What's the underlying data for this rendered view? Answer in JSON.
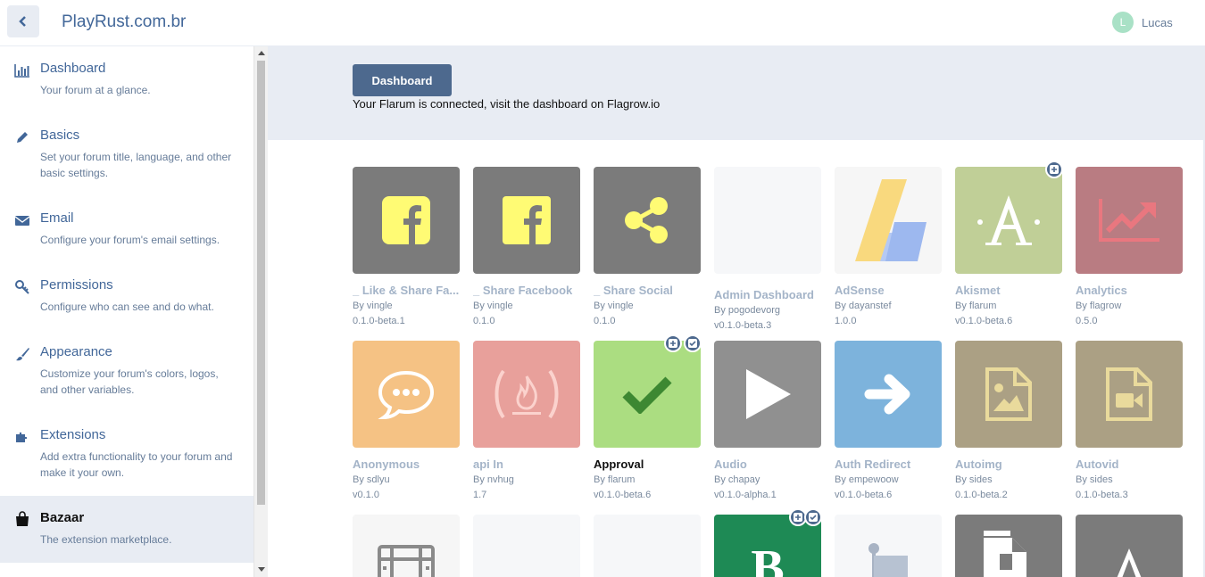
{
  "header": {
    "site_title": "PlayRust.com.br",
    "user_initial": "L",
    "user_name": "Lucas"
  },
  "sidebar": {
    "items": [
      {
        "label": "Dashboard",
        "desc": "Your forum at a glance.",
        "icon": "chart-icon"
      },
      {
        "label": "Basics",
        "desc": "Set your forum title, language, and other basic settings.",
        "icon": "pencil-icon"
      },
      {
        "label": "Email",
        "desc": "Configure your forum's email settings.",
        "icon": "envelope-icon"
      },
      {
        "label": "Permissions",
        "desc": "Configure who can see and do what.",
        "icon": "key-icon"
      },
      {
        "label": "Appearance",
        "desc": "Customize your forum's colors, logos, and other variables.",
        "icon": "paintbrush-icon"
      },
      {
        "label": "Extensions",
        "desc": "Add extra functionality to your forum and make it your own.",
        "icon": "puzzle-icon"
      },
      {
        "label": "Bazaar",
        "desc": "The extension marketplace.",
        "icon": "shopping-bag-icon"
      }
    ]
  },
  "banner": {
    "button_label": "Dashboard",
    "text": "Your Flarum is connected, visit the dashboard on Flagrow.io"
  },
  "extensions": [
    {
      "title": "_ Like & Share Fa...",
      "author": "By vingle",
      "version": "0.1.0-beta.1",
      "bg": "#7b7b7b",
      "icon": "facebook-icon"
    },
    {
      "title": "_ Share Facebook",
      "author": "By vingle",
      "version": "0.1.0",
      "bg": "#7b7b7b",
      "icon": "facebook-icon"
    },
    {
      "title": "_ Share Social",
      "author": "By vingle",
      "version": "0.1.0",
      "bg": "#7b7b7b",
      "icon": "share-icon"
    },
    {
      "title": "Admin Dashboard",
      "author": "By pogodevorg",
      "version": "v0.1.0-beta.3",
      "bg": "#f6f7f9",
      "icon": "none"
    },
    {
      "title": "AdSense",
      "author": "By dayanstef",
      "version": "1.0.0",
      "bg": "#f6f6f6",
      "icon": "adsense-icon"
    },
    {
      "title": "Akismet",
      "author": "By flarum",
      "version": "v0.1.0-beta.6",
      "bg": "#c0cf97",
      "icon": "akismet-icon"
    },
    {
      "title": "Analytics",
      "author": "By flagrow",
      "version": "0.5.0",
      "bg": "#b97c82",
      "icon": "chart-line-icon"
    },
    {
      "title": "Anonymous",
      "author": "By sdlyu",
      "version": "v0.1.0",
      "bg": "#f5c284",
      "icon": "speech-bubble-icon"
    },
    {
      "title": "api In",
      "author": "By nvhug",
      "version": "1.7",
      "bg": "#e8a09b",
      "icon": "fire-icon"
    },
    {
      "title": "Approval",
      "author": "By flarum",
      "version": "v0.1.0-beta.6",
      "bg": "#abdd81",
      "icon": "check-icon"
    },
    {
      "title": "Audio",
      "author": "By chapay",
      "version": "v0.1.0-alpha.1",
      "bg": "#909090",
      "icon": "play-icon"
    },
    {
      "title": "Auth Redirect",
      "author": "By empewoow",
      "version": "v0.1.0-beta.6",
      "bg": "#7db3dc",
      "icon": "arrow-right-icon"
    },
    {
      "title": "Autoimg",
      "author": "By sides",
      "version": "0.1.0-beta.2",
      "bg": "#aba084",
      "icon": "image-file-icon"
    },
    {
      "title": "Autovid",
      "author": "By sides",
      "version": "0.1.0-beta.3",
      "bg": "#aba084",
      "icon": "video-file-icon"
    },
    {
      "title": "",
      "author": "",
      "version": "",
      "bg": "#f6f6f6",
      "icon": "film-icon"
    },
    {
      "title": "",
      "author": "",
      "version": "",
      "bg": "#f6f7f9",
      "icon": "none"
    },
    {
      "title": "",
      "author": "",
      "version": "",
      "bg": "#f6f7f9",
      "icon": "none"
    },
    {
      "title": "",
      "author": "",
      "version": "",
      "bg": "#1e8a55",
      "icon": "b-letter-icon"
    },
    {
      "title": "",
      "author": "",
      "version": "",
      "bg": "#f6f7f9",
      "icon": "flag-icon"
    },
    {
      "title": "",
      "author": "",
      "version": "",
      "bg": "#7b7b7b",
      "icon": "document-icon"
    },
    {
      "title": "",
      "author": "",
      "version": "",
      "bg": "#7b7b7b",
      "icon": "a-letter-icon"
    }
  ]
}
